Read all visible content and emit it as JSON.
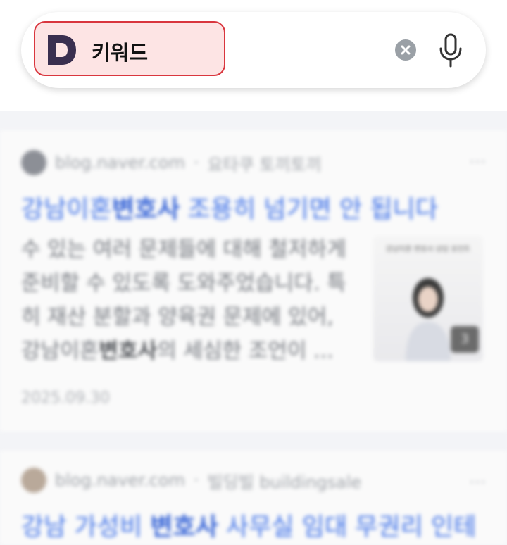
{
  "search": {
    "keyword": "키워드",
    "logo_letter": "D",
    "clear_icon": "clear-icon",
    "mic_icon": "mic-icon"
  },
  "results": [
    {
      "source": "blog.naver.com",
      "author": "요타쿠 토끼토끼",
      "title_prefix": "강남이혼",
      "title_highlight": "변호사",
      "title_suffix": " 조용히 넘기면 안 됩니다",
      "snippet": "수 있는 여러 문제들에 대해 철저하게 준비할 수 있도록 도와주었습니다. 특히 재산 분할과 양육권 문제에 있어, 강남이혼",
      "snippet_highlight": "변호사",
      "snippet_suffix": "의 세심한 조언이 ...",
      "date": "2025.09.30",
      "thumb_caption": "강남이혼 변호사 상담 포인트",
      "thumb_badge": "3"
    },
    {
      "source": "blog.naver.com",
      "author": "빌딩빌 buildingsale",
      "title_prefix": "강남 가성비 ",
      "title_highlight": "변호사",
      "title_suffix": " 사무실 임대 무권리 인테"
    }
  ],
  "colors": {
    "accent_red": "#d9363e",
    "link_blue": "#3b6fe8",
    "logo_purple": "#3a2f4f"
  }
}
